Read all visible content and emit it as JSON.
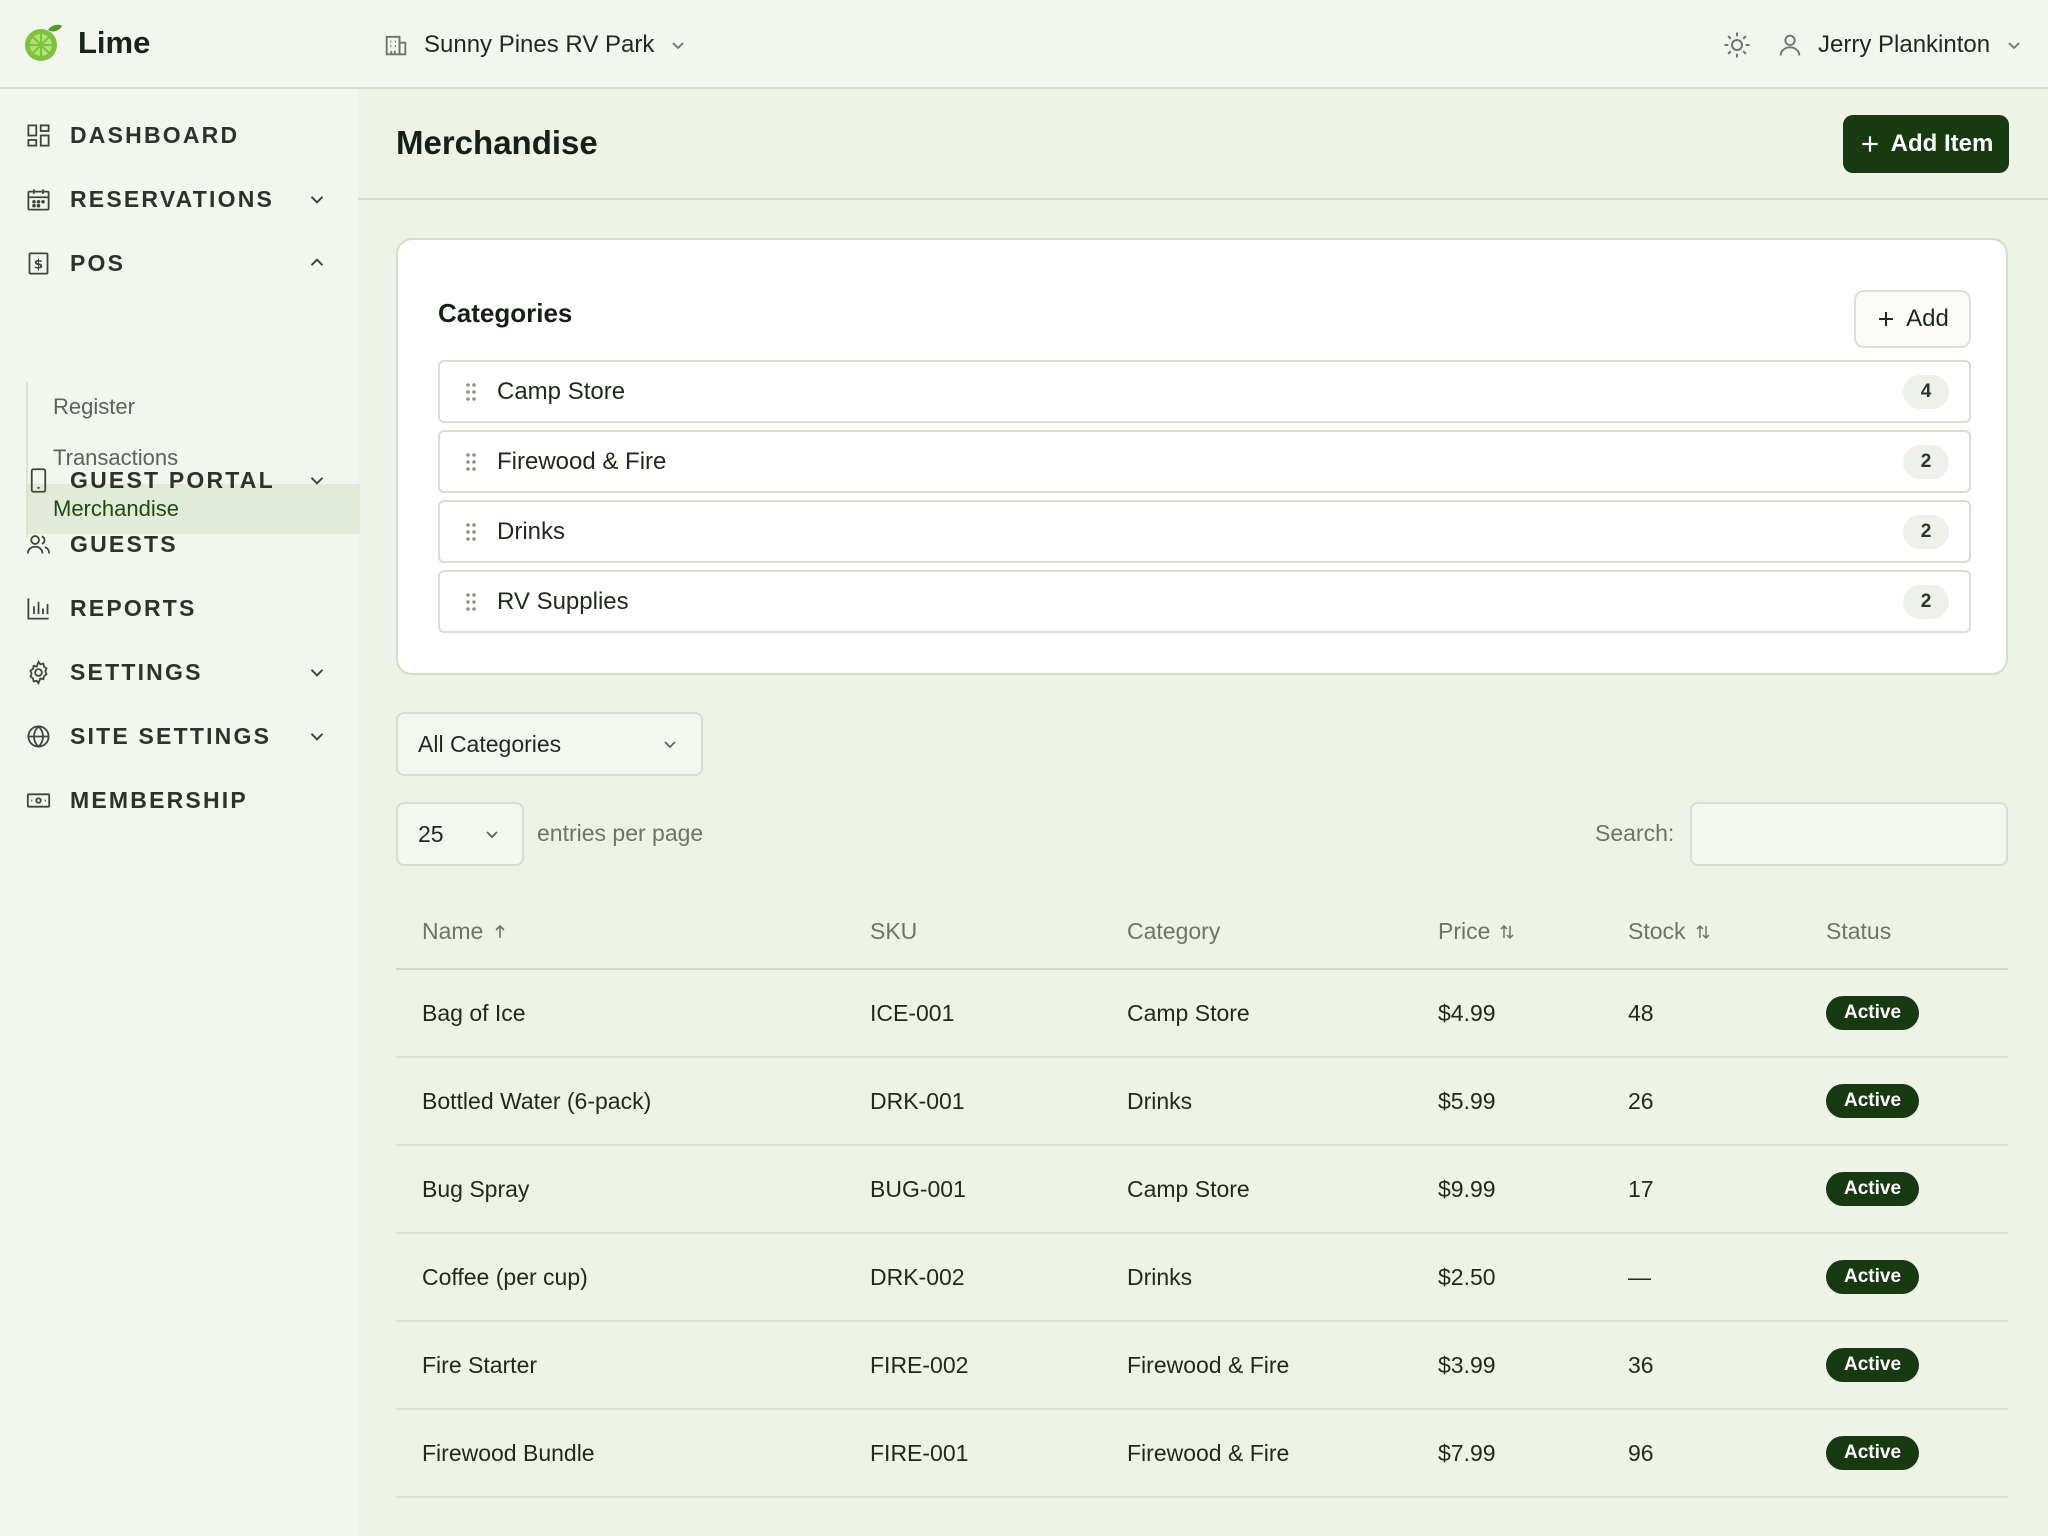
{
  "brand": {
    "name": "Lime"
  },
  "header": {
    "park_name": "Sunny Pines RV Park",
    "user_name": "Jerry Plankinton"
  },
  "sidebar": {
    "items": [
      {
        "label": "DASHBOARD",
        "icon": "dashboard-icon",
        "has_chevron": false
      },
      {
        "label": "RESERVATIONS",
        "icon": "calendar-icon",
        "has_chevron": true,
        "expanded": false
      },
      {
        "label": "POS",
        "icon": "pos-receipt-icon",
        "has_chevron": true,
        "expanded": true
      },
      {
        "label": "GUEST PORTAL",
        "icon": "tablet-icon",
        "has_chevron": true,
        "expanded": false
      },
      {
        "label": "GUESTS",
        "icon": "users-icon",
        "has_chevron": false
      },
      {
        "label": "REPORTS",
        "icon": "bar-chart-icon",
        "has_chevron": false
      },
      {
        "label": "SETTINGS",
        "icon": "gear-icon",
        "has_chevron": true,
        "expanded": false
      },
      {
        "label": "SITE SETTINGS",
        "icon": "globe-icon",
        "has_chevron": true,
        "expanded": false
      },
      {
        "label": "MEMBERSHIP",
        "icon": "membership-card-icon",
        "has_chevron": false
      }
    ],
    "pos_subitems": [
      {
        "label": "Register",
        "active": false
      },
      {
        "label": "Transactions",
        "active": false
      },
      {
        "label": "Merchandise",
        "active": true
      }
    ]
  },
  "page": {
    "title": "Merchandise",
    "add_item_label": "Add Item"
  },
  "categories": {
    "title": "Categories",
    "add_label": "Add",
    "items": [
      {
        "name": "Camp Store",
        "count": "4"
      },
      {
        "name": "Firewood & Fire",
        "count": "2"
      },
      {
        "name": "Drinks",
        "count": "2"
      },
      {
        "name": "RV Supplies",
        "count": "2"
      }
    ]
  },
  "filters": {
    "category_selected": "All Categories",
    "per_page_selected": "25",
    "per_page_label": "entries per page",
    "search_label": "Search:",
    "search_value": ""
  },
  "table": {
    "columns": [
      {
        "label": "Name",
        "sort": "asc"
      },
      {
        "label": "SKU",
        "sort": "none"
      },
      {
        "label": "Category",
        "sort": "none"
      },
      {
        "label": "Price",
        "sort": "both"
      },
      {
        "label": "Stock",
        "sort": "both"
      },
      {
        "label": "Status",
        "sort": "none"
      }
    ],
    "rows": [
      {
        "name": "Bag of Ice",
        "sku": "ICE-001",
        "category": "Camp Store",
        "price": "$4.99",
        "stock": "48",
        "status": "Active"
      },
      {
        "name": "Bottled Water (6-pack)",
        "sku": "DRK-001",
        "category": "Drinks",
        "price": "$5.99",
        "stock": "26",
        "status": "Active"
      },
      {
        "name": "Bug Spray",
        "sku": "BUG-001",
        "category": "Camp Store",
        "price": "$9.99",
        "stock": "17",
        "status": "Active"
      },
      {
        "name": "Coffee (per cup)",
        "sku": "DRK-002",
        "category": "Drinks",
        "price": "$2.50",
        "stock": "—",
        "status": "Active"
      },
      {
        "name": "Fire Starter",
        "sku": "FIRE-002",
        "category": "Firewood & Fire",
        "price": "$3.99",
        "stock": "36",
        "status": "Active"
      },
      {
        "name": "Firewood Bundle",
        "sku": "FIRE-001",
        "category": "Firewood & Fire",
        "price": "$7.99",
        "stock": "96",
        "status": "Active"
      }
    ]
  },
  "colors": {
    "accent": "#173a11",
    "logo_green": "#7bc43a",
    "background": "#edf3e6"
  }
}
